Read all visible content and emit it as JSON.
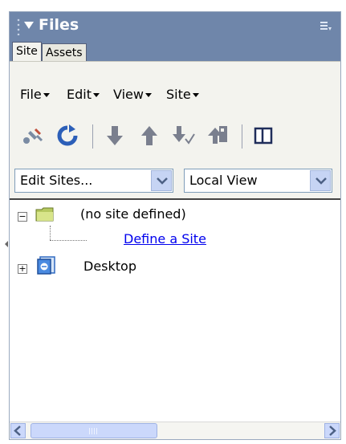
{
  "panel": {
    "title": "Files",
    "tabs": [
      {
        "label": "Site",
        "active": true
      },
      {
        "label": "Assets",
        "active": false
      }
    ]
  },
  "menus": [
    "File",
    "Edit",
    "View",
    "Site"
  ],
  "toolbar": {
    "icons": [
      "connect-icon",
      "refresh-icon",
      "get-files-icon",
      "put-files-icon",
      "check-out-icon",
      "check-in-icon",
      "expand-icon"
    ]
  },
  "selects": {
    "site": {
      "value": "Edit Sites..."
    },
    "view": {
      "value": "Local View"
    }
  },
  "tree": {
    "root": {
      "label": "(no site defined)",
      "child_link": "Define a Site"
    },
    "desktop": {
      "label": "Desktop"
    }
  },
  "colors": {
    "titlebar": "#6f86aa",
    "panel": "#f3f3ee",
    "link": "#0000ee"
  }
}
